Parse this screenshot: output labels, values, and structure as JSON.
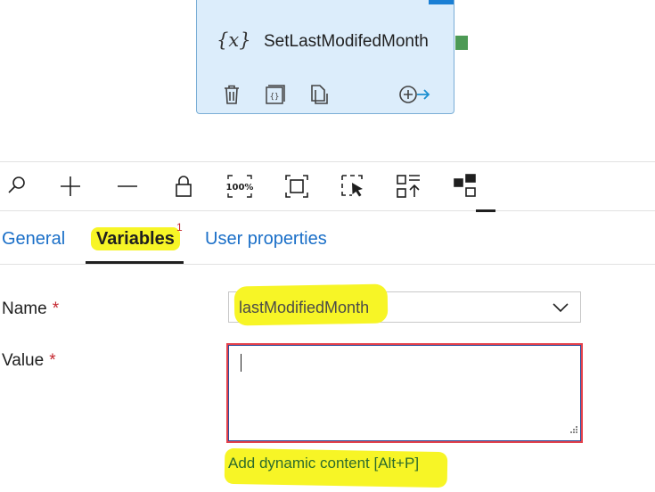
{
  "activity": {
    "icon_text": "{x}",
    "name": "SetLastModifedMonth",
    "actions": [
      "delete-icon",
      "code-icon",
      "copy-icon",
      "add-output-icon"
    ]
  },
  "toolbar": {
    "buttons": [
      "search-icon",
      "zoom-in-icon",
      "zoom-out-icon",
      "lock-icon",
      "zoom-100-icon",
      "fit-to-window-icon",
      "select-icon",
      "auto-align-icon",
      "layout-icon"
    ],
    "zoom_100_label": "100%"
  },
  "tabs": [
    {
      "label": "General"
    },
    {
      "label": "Variables",
      "badge": "1"
    },
    {
      "label": "User properties"
    }
  ],
  "form": {
    "name_label": "Name",
    "value_label": "Value",
    "required_mark": "*",
    "name_value": "lastModifiedMonth",
    "value_text": "",
    "dynamic_link": "Add dynamic content [Alt+P]"
  },
  "colors": {
    "accent": "#1a6fc8",
    "highlight": "#f7f526",
    "error_border": "#e4414b",
    "node_background": "#dcedfb",
    "port": "#4d9a55"
  }
}
